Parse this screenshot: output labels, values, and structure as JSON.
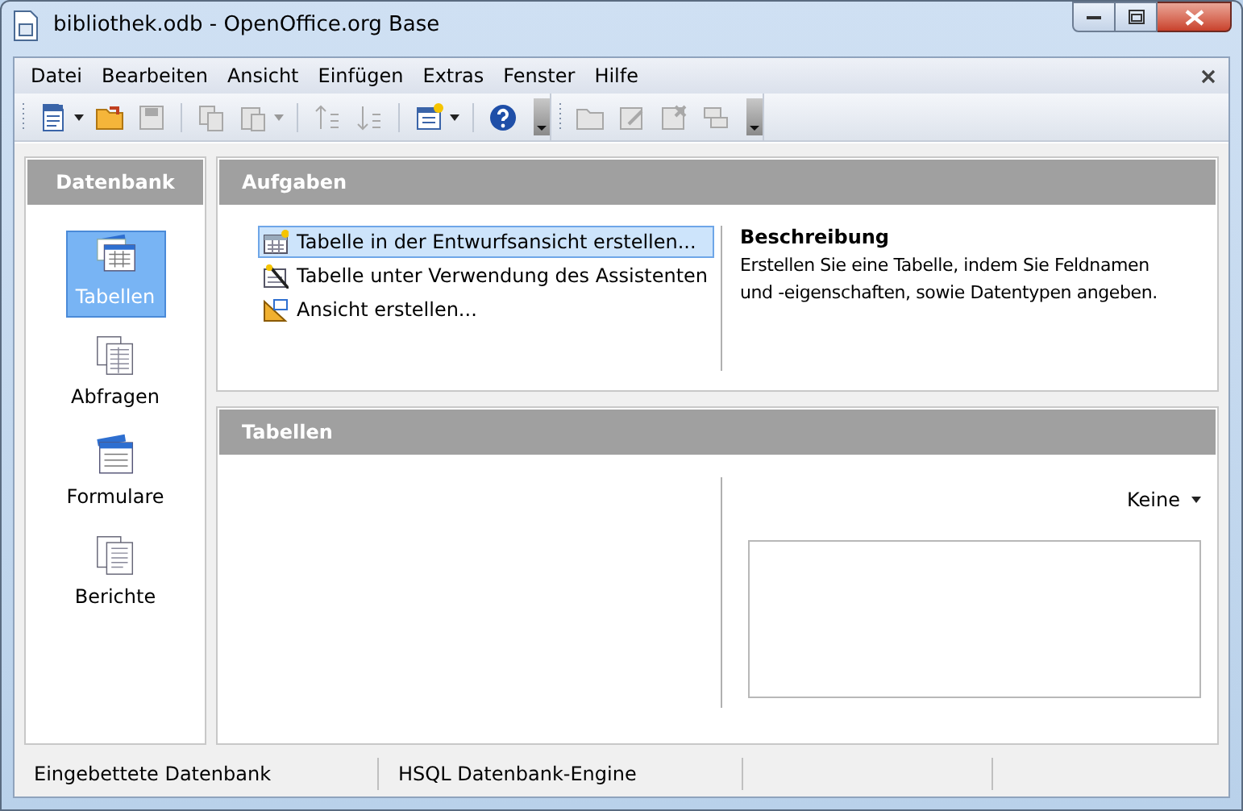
{
  "window": {
    "title": "bibliothek.odb - OpenOffice.org Base"
  },
  "menu": [
    "Datei",
    "Bearbeiten",
    "Ansicht",
    "Einfügen",
    "Extras",
    "Fenster",
    "Hilfe"
  ],
  "toolbars": [
    [
      {
        "kind": "doc",
        "dropdown": true,
        "disabled": false
      },
      {
        "kind": "folder",
        "dropdown": false,
        "disabled": false
      },
      {
        "kind": "save",
        "dropdown": false,
        "disabled": true
      },
      {
        "kind": "sep"
      },
      {
        "kind": "copy",
        "dropdown": false,
        "disabled": true
      },
      {
        "kind": "paste",
        "dropdown": true,
        "disabled": true
      },
      {
        "kind": "sep"
      },
      {
        "kind": "sortup",
        "dropdown": false,
        "disabled": true
      },
      {
        "kind": "sortdown",
        "dropdown": false,
        "disabled": true
      },
      {
        "kind": "sep"
      },
      {
        "kind": "form",
        "dropdown": true,
        "disabled": false
      },
      {
        "kind": "sep"
      },
      {
        "kind": "help",
        "dropdown": false,
        "disabled": false
      }
    ],
    [
      {
        "kind": "folder",
        "dropdown": false,
        "disabled": true
      },
      {
        "kind": "edit",
        "dropdown": false,
        "disabled": true
      },
      {
        "kind": "delete",
        "dropdown": false,
        "disabled": true
      },
      {
        "kind": "rename",
        "dropdown": false,
        "disabled": true
      }
    ]
  ],
  "sidebar": {
    "title": "Datenbank",
    "items": [
      {
        "label": "Tabellen",
        "kind": "table",
        "selected": true
      },
      {
        "label": "Abfragen",
        "kind": "query",
        "selected": false
      },
      {
        "label": "Formulare",
        "kind": "form",
        "selected": false
      },
      {
        "label": "Berichte",
        "kind": "report",
        "selected": false
      }
    ]
  },
  "tasks": {
    "title": "Aufgaben",
    "items": [
      {
        "label": "Tabelle in der Entwurfsansicht erstellen...",
        "kind": "design",
        "selected": true
      },
      {
        "label": "Tabelle unter Verwendung des Assistenten",
        "kind": "wizard",
        "selected": false
      },
      {
        "label": "Ansicht erstellen...",
        "kind": "view",
        "selected": false
      }
    ],
    "description_title": "Beschreibung",
    "description": "Erstellen Sie eine Tabelle, indem Sie Feldnamen und -eigenschaften, sowie Datentypen angeben."
  },
  "tables": {
    "title": "Tabellen",
    "preview_dropdown": "Keine"
  },
  "status_bar": [
    "Eingebettete Datenbank",
    "HSQL Datenbank-Engine"
  ]
}
